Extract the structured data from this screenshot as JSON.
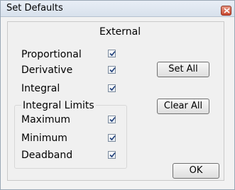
{
  "window": {
    "title": "Set Defaults"
  },
  "panel": {
    "heading": "External"
  },
  "options": {
    "proportional": {
      "label": "Proportional",
      "checked": true
    },
    "derivative": {
      "label": "Derivative",
      "checked": true
    },
    "integral": {
      "label": "Integral",
      "checked": true
    }
  },
  "integral_limits": {
    "group_label": "Integral Limits",
    "maximum": {
      "label": "Maximum",
      "checked": true
    },
    "minimum": {
      "label": "Minimum",
      "checked": true
    },
    "deadband": {
      "label": "Deadband",
      "checked": true
    }
  },
  "buttons": {
    "set_all": "Set All",
    "clear_all": "Clear All",
    "ok": "OK"
  },
  "icons": {
    "close": "close-icon",
    "check": "checkmark-icon"
  },
  "colors": {
    "close_button": "#c9482e",
    "check": "#1f3f7a"
  }
}
